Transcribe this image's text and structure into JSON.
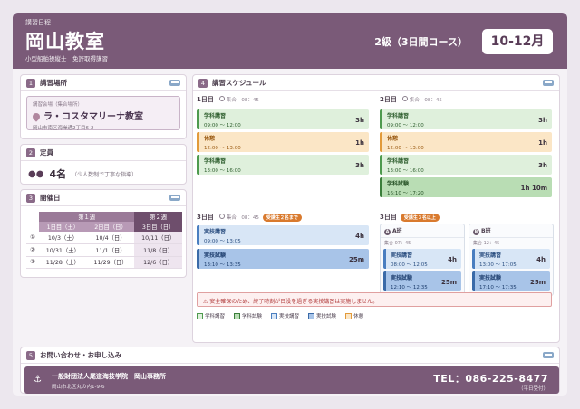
{
  "header": {
    "kicker": "講習日程",
    "title": "岡山教室",
    "subtitle": "小型船舶操縦士　免許取得講習",
    "grade": "2級（3日間コース）",
    "months": "10-12月"
  },
  "venue": {
    "number": "1",
    "title": "講習場所",
    "label": "講習会場（集合場所）",
    "name": "ラ・コスタマリーナ教室",
    "address": "岡山市南区海岸通2丁目6-2"
  },
  "capacity": {
    "number": "2",
    "title": "定員",
    "value": "4名",
    "note": "（少人数制で丁寧な指導）"
  },
  "dates": {
    "number": "3",
    "title": "開催日",
    "week1": "第１週",
    "week2": "第２週",
    "col1": "1日目（土）",
    "col2": "2日目（日）",
    "col3": "3日目（日）",
    "rows": [
      {
        "no": "①",
        "d1": "10/3（土）",
        "d2": "10/4（日）",
        "d3": "10/11（日）"
      },
      {
        "no": "②",
        "d1": "10/31（土）",
        "d2": "11/1（日）",
        "d3": "11/8（日）"
      },
      {
        "no": "③",
        "d1": "11/28（土）",
        "d2": "11/29（日）",
        "d3": "12/6（日）"
      }
    ]
  },
  "schedule": {
    "number": "4",
    "title": "講習スケジュール",
    "day1": {
      "label": "1日目",
      "meet": "集合　08：45",
      "blocks": [
        {
          "name": "学科講習",
          "time": "09:00 ～ 12:00",
          "dur": "3h"
        },
        {
          "name": "休憩",
          "time": "12:00 ～ 13:00",
          "dur": "1h"
        },
        {
          "name": "学科講習",
          "time": "13:00 ～ 16:00",
          "dur": "3h"
        }
      ]
    },
    "day2": {
      "label": "2日目",
      "meet": "集合　08：45",
      "blocks": [
        {
          "name": "学科講習",
          "time": "09:00 ～ 12:00",
          "dur": "3h"
        },
        {
          "name": "休憩",
          "time": "12:00 ～ 13:00",
          "dur": "1h"
        },
        {
          "name": "学科講習",
          "time": "13:00 ～ 16:00",
          "dur": "3h"
        },
        {
          "name": "学科試験",
          "time": "16:10 ～ 17:20",
          "dur": "1h 10m"
        }
      ]
    },
    "day3a": {
      "label": "3日目",
      "meet": "集合　08：45",
      "pill": "受講生２名まで",
      "blocks": [
        {
          "name": "実技講習",
          "time": "09:00 ～ 13:05",
          "dur": "4h"
        },
        {
          "name": "実技試験",
          "time": "13:10 ～ 13:35",
          "dur": "25m"
        }
      ]
    },
    "day3b": {
      "label": "3日目",
      "pill": "受講生３名以上",
      "groupA": {
        "icon": "A",
        "title": "A班",
        "meet": "集合 07：45",
        "blocks": [
          {
            "name": "実技講習",
            "time": "08:00 ～ 12:05",
            "dur": "4h"
          },
          {
            "name": "実技試験",
            "time": "12:10 ～ 12:35",
            "dur": "25m"
          }
        ]
      },
      "groupB": {
        "icon": "B",
        "title": "B班",
        "meet": "集合 12：45",
        "blocks": [
          {
            "name": "実技講習",
            "time": "13:00 ～ 17:05",
            "dur": "4h"
          },
          {
            "name": "実技試験",
            "time": "17:10 ～ 17:35",
            "dur": "25m"
          }
        ]
      }
    },
    "warning": "⚠ 安全確保のため、終了時刻が日没を過ぎる実技講習は実施しません。",
    "legend": [
      "学科講習",
      "学科試験",
      "実技講習",
      "実技試験",
      "休憩"
    ]
  },
  "contact": {
    "number": "5",
    "title": "お問い合わせ・お申し込み",
    "org": "一般財団法人尾道海技学院　岡山事務所",
    "address": "岡山市北区丸の内1-9-6",
    "tel": "TEL：086-225-8477",
    "hours": "（平日受付）"
  },
  "colors": {
    "brand": "#7a5a78",
    "lecture": "#dff0dc",
    "lecture_exam": "#b9ddb4",
    "practical": "#d8e6f6",
    "practical_exam": "#a8c4e8",
    "break": "#fbe6c6",
    "warning": "#b03a3a"
  }
}
